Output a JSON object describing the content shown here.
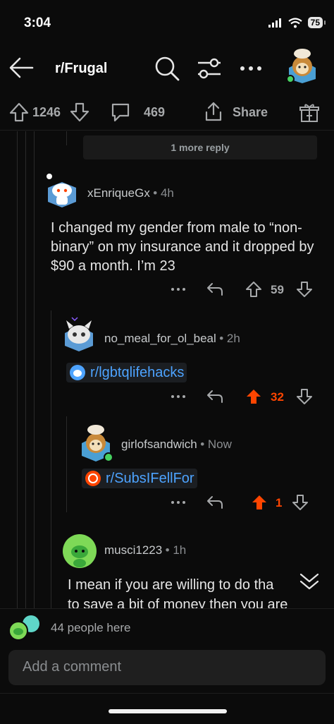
{
  "status_bar": {
    "time": "3:04",
    "battery": "75"
  },
  "header": {
    "subreddit": "r/Frugal"
  },
  "post_actions": {
    "upvotes": "1246",
    "comments": "469",
    "share_label": "Share"
  },
  "thread": {
    "more_reply_label": "1 more reply",
    "comments": [
      {
        "username": "xEnriqueGx",
        "time": "• 4h",
        "body": "I changed my gender from male to “non-binary” on my insurance and it dropped by $90 a month. I’m 23",
        "votes": "59"
      },
      {
        "username": "no_meal_for_ol_beal",
        "time": "• 2h",
        "link": "r/lgbtqlifehacks",
        "votes": "32"
      },
      {
        "username": "girlofsandwich",
        "time": "• Now",
        "link": "r/SubsIFellFor",
        "votes": "1"
      },
      {
        "username": "musci1223",
        "time": "• 1h",
        "body_line1": "I mean if you are willing to do tha",
        "body_line2": "to save a bit of money then you are"
      }
    ]
  },
  "footer": {
    "people_here": "44 people here",
    "comment_placeholder": "Add a comment"
  },
  "colors": {
    "background": "#0b0b0b",
    "upvote_active": "#ff4500",
    "link": "#4da3ff"
  }
}
